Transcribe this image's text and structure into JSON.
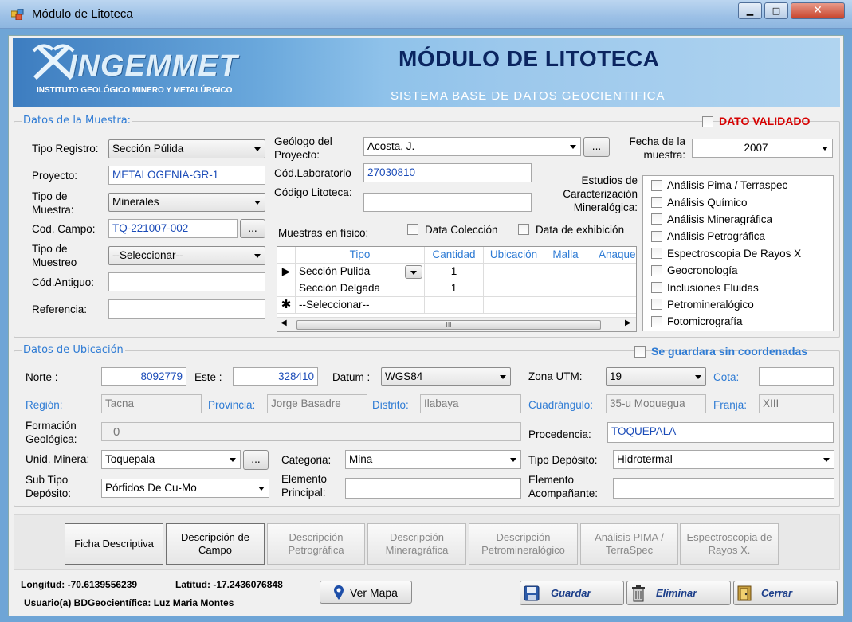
{
  "window": {
    "title": "Módulo de Litoteca"
  },
  "banner": {
    "logo": "INGEMMET",
    "logo_sub": "INSTITUTO GEOLÓGICO MINERO Y METALÚRGICO",
    "title": "MÓDULO DE LITOTECA",
    "subtitle": "SISTEMA BASE DE DATOS GEOCIENTIFICA"
  },
  "muestra": {
    "legend": "Datos de la Muestra:",
    "validado_label": "DATO VALIDADO",
    "tipo_registro": {
      "label": "Tipo Registro:",
      "value": "Sección Púlida"
    },
    "proyecto": {
      "label": "Proyecto:",
      "value": "METALOGENIA-GR-1"
    },
    "tipo_muestra": {
      "label": "Tipo de Muestra:",
      "value": "Minerales"
    },
    "cod_campo": {
      "label": "Cod. Campo:",
      "value": "TQ-221007-002",
      "btn": "..."
    },
    "tipo_muestreo": {
      "label": "Tipo de Muestreo",
      "value": "--Seleccionar--"
    },
    "cod_antiguo": {
      "label": "Cód.Antiguo:",
      "value": ""
    },
    "referencia": {
      "label": "Referencia:",
      "value": ""
    },
    "geologo": {
      "label": "Geólogo del Proyecto:",
      "value": "Acosta, J.",
      "btn": "..."
    },
    "cod_laboratorio": {
      "label": "Cód.Laboratorio",
      "value": "27030810"
    },
    "codigo_litoteca": {
      "label": "Código Litoteca:",
      "value": ""
    },
    "fecha": {
      "label": "Fecha de la muestra:",
      "value": "2007"
    },
    "estudios": {
      "label": "Estudios de Caracterización Mineralógica:",
      "items": [
        "Análisis Pima / Terraspec",
        "Análisis Químico",
        "Análisis Mineragráfica",
        "Análisis Petrográfica",
        "Espectroscopia De Rayos X",
        "Geocronología",
        "Inclusiones Fluidas",
        "Petromineralógico",
        "Fotomicrografía"
      ]
    },
    "fisico": {
      "label": "Muestras en físico:",
      "data_coleccion": "Data Colección",
      "data_exhibicion": "Data de exhibición",
      "columns": [
        "Tipo",
        "Cantidad",
        "Ubicación",
        "Malla",
        "Anaque"
      ],
      "rows": [
        {
          "tipo": "Sección Pulida",
          "cantidad": "1"
        },
        {
          "tipo": "Sección Delgada",
          "cantidad": "1"
        },
        {
          "tipo": "--Seleccionar--",
          "cantidad": ""
        }
      ],
      "scroll_grip": "III"
    }
  },
  "ubicacion": {
    "legend": "Datos de Ubicación",
    "sin_coord": "Se guardara sin coordenadas",
    "norte": {
      "label": "Norte :",
      "value": "8092779"
    },
    "este": {
      "label": "Este :",
      "value": "328410"
    },
    "datum": {
      "label": "Datum :",
      "value": "WGS84"
    },
    "zona": {
      "label": "Zona UTM:",
      "value": "19"
    },
    "cota": {
      "label": "Cota:",
      "value": ""
    },
    "region": {
      "label": "Región:",
      "value": "Tacna"
    },
    "provincia": {
      "label": "Provincia:",
      "value": "Jorge Basadre"
    },
    "distrito": {
      "label": "Distrito:",
      "value": "Ilabaya"
    },
    "cuadrangulo": {
      "label": "Cuadrángulo:",
      "value": "35-u Moquegua"
    },
    "franja": {
      "label": "Franja:",
      "value": "XIII"
    },
    "formacion": {
      "label": "Formación Geológica:",
      "value": "0"
    },
    "procedencia": {
      "label": "Procedencia:",
      "value": "TOQUEPALA"
    },
    "unid_minera": {
      "label": "Unid. Minera:",
      "value": "Toquepala",
      "btn": "..."
    },
    "categoria": {
      "label": "Categoria:",
      "value": "Mina"
    },
    "tipo_deposito": {
      "label": "Tipo Depósito:",
      "value": "Hidrotermal"
    },
    "sub_tipo": {
      "label": "Sub Tipo Depósito:",
      "value": "Pórfidos De Cu-Mo"
    },
    "elemento_principal": {
      "label": "Elemento Principal:",
      "value": ""
    },
    "elemento_acomp": {
      "label": "Elemento Acompañante:",
      "value": ""
    }
  },
  "tabs": [
    {
      "label": "Ficha Descriptiva"
    },
    {
      "label": "Descripción de Campo"
    },
    {
      "label": "Descripción Petrográfica"
    },
    {
      "label": "Descripción Mineragráfica"
    },
    {
      "label": "Descripción Petromineralógico"
    },
    {
      "label": "Análisis PIMA / TerraSpec"
    },
    {
      "label": "Espectroscopia de Rayos X."
    }
  ],
  "footer": {
    "longitud": "Longitud: -70.6139556239",
    "latitud": "Latitud: -17.2436076848",
    "usuario": "Usuario(a) BDGeocientífica: Luz Maria Montes",
    "ver_mapa": "Ver Mapa",
    "guardar": "Guardar",
    "eliminar": "Eliminar",
    "cerrar": "Cerrar"
  },
  "colors": {
    "accent": "#2e7bd4",
    "validado": "#d60000",
    "banner_title": "#0b2560"
  }
}
